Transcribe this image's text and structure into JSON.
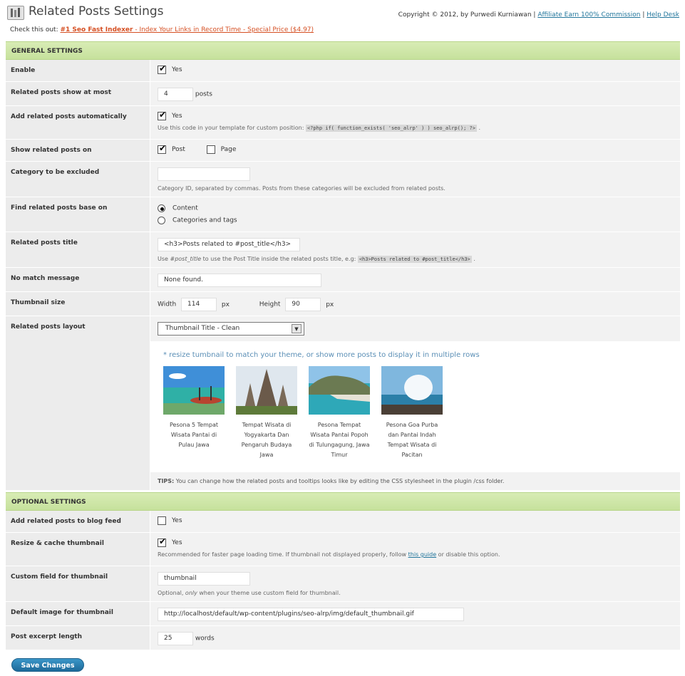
{
  "header": {
    "title": "Related Posts Settings",
    "copyright": "Copyright © 2012, by Purwedi Kurniawan",
    "affiliate_link": "Affiliate Earn 100% Commission",
    "help_link": "Help Desk",
    "separator": "|",
    "promo_prefix": "Check this out:",
    "promo_bold": "#1 Seo Fast Indexer",
    "promo_rest": " - Index Your Links in Record Time - Special Price ($4.97)"
  },
  "general": {
    "section_title": "GENERAL SETTINGS",
    "enable": {
      "label": "Enable",
      "checked": true,
      "option": "Yes"
    },
    "show_at_most": {
      "label": "Related posts show at most",
      "value": "4",
      "suffix": "posts"
    },
    "auto_add": {
      "label": "Add related posts automatically",
      "checked": true,
      "option": "Yes",
      "note_prefix": "Use this code in your template for custom position:",
      "code": "<?php if( function_exists( 'seo_alrp' ) ) seo_alrp(); ?>",
      "note_suffix": "."
    },
    "show_on": {
      "label": "Show related posts on",
      "post": "Post",
      "post_checked": true,
      "page": "Page",
      "page_checked": false
    },
    "exclude_category": {
      "label": "Category to be excluded",
      "value": "",
      "note": "Category ID, separated by commas. Posts from these categories will be excluded from related posts."
    },
    "find_base": {
      "label": "Find related posts base on",
      "options": [
        "Content",
        "Categories and tags"
      ],
      "selected": "Content"
    },
    "posts_title": {
      "label": "Related posts title",
      "value": "<h3>Posts related to #post_title</h3>",
      "note_prefix": "Use ",
      "note_em": "#post_title",
      "note_mid": " to use the Post Title inside the related posts title, e.g:",
      "code": "<h3>Posts related to #post_title</h3>",
      "note_suffix": "."
    },
    "no_match": {
      "label": "No match message",
      "value": "None found."
    },
    "thumb_size": {
      "label": "Thumbnail size",
      "width_label": "Width",
      "width": "114",
      "height_label": "Height",
      "height": "90",
      "unit": "px"
    },
    "layout": {
      "label": "Related posts layout",
      "selected": "Thumbnail Title - Clean",
      "preview_hint": "* resize tumbnail to match your theme, or show more posts to display it in multiple rows",
      "posts": [
        {
          "caption": "Pesona 5 Tempat Wisata Pantai di Pulau Jawa"
        },
        {
          "caption": "Tempat Wisata di Yogyakarta Dan Pengaruh Budaya Jawa"
        },
        {
          "caption": "Pesona Tempat Wisata Pantai Popoh di Tulungagung, Jawa Timur"
        },
        {
          "caption": "Pesona Goa Purba dan Pantai Indah Tempat Wisata di Pacitan"
        }
      ],
      "tips_bold": "TIPS:",
      "tips": " You can change how the related posts and tooltips looks like by editing the CSS stylesheet in the plugin /css folder."
    }
  },
  "optional": {
    "section_title": "OPTIONAL SETTINGS",
    "blog_feed": {
      "label": "Add related posts to blog feed",
      "checked": false,
      "option": "Yes"
    },
    "resize_cache": {
      "label": "Resize & cache thumbnail",
      "checked": true,
      "option": "Yes",
      "note_prefix": "Recommended for faster page loading time. If thumbnail not displayed properly, follow ",
      "note_link": "this guide",
      "note_suffix": " or disable this option."
    },
    "custom_field": {
      "label": "Custom field for thumbnail",
      "value": "thumbnail",
      "note_prefix": "Optional, ",
      "note_em": "only",
      "note_suffix": " when your theme use custom field for thumbnail."
    },
    "default_image": {
      "label": "Default image for thumbnail",
      "value": "http://localhost/default/wp-content/plugins/seo-alrp/img/default_thumbnail.gif"
    },
    "excerpt_length": {
      "label": "Post excerpt length",
      "value": "25",
      "suffix": "words"
    }
  },
  "save_button": "Save Changes",
  "colors": {
    "section_bg": "#c6e19c",
    "link": "#21759b",
    "promo_link": "#d54e21",
    "button": "#2a80b4"
  }
}
